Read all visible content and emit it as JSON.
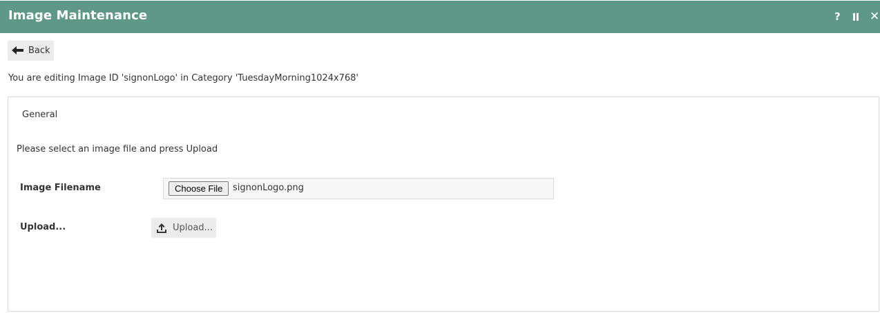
{
  "window": {
    "title": "Image Maintenance",
    "controls": {
      "help": "?",
      "close": "✕"
    }
  },
  "toolbar": {
    "back_label": "Back"
  },
  "edit_info": "You are editing Image ID 'signonLogo' in Category 'TuesdayMorning1024x768'",
  "panel": {
    "tab_label": "General",
    "instruction": "Please select an image file and press Upload",
    "fields": {
      "filename_label": "Image Filename",
      "choose_file_label": "Choose File",
      "selected_file": "signonLogo.png",
      "upload_label": "Upload...",
      "upload_button_label": "Upload..."
    }
  },
  "colors": {
    "titlebar_bg": "#5f9888",
    "button_bg": "#ececec"
  },
  "icons": {
    "back": "arrow-left-icon",
    "upload": "upload-icon",
    "pause": "pause-icon"
  }
}
